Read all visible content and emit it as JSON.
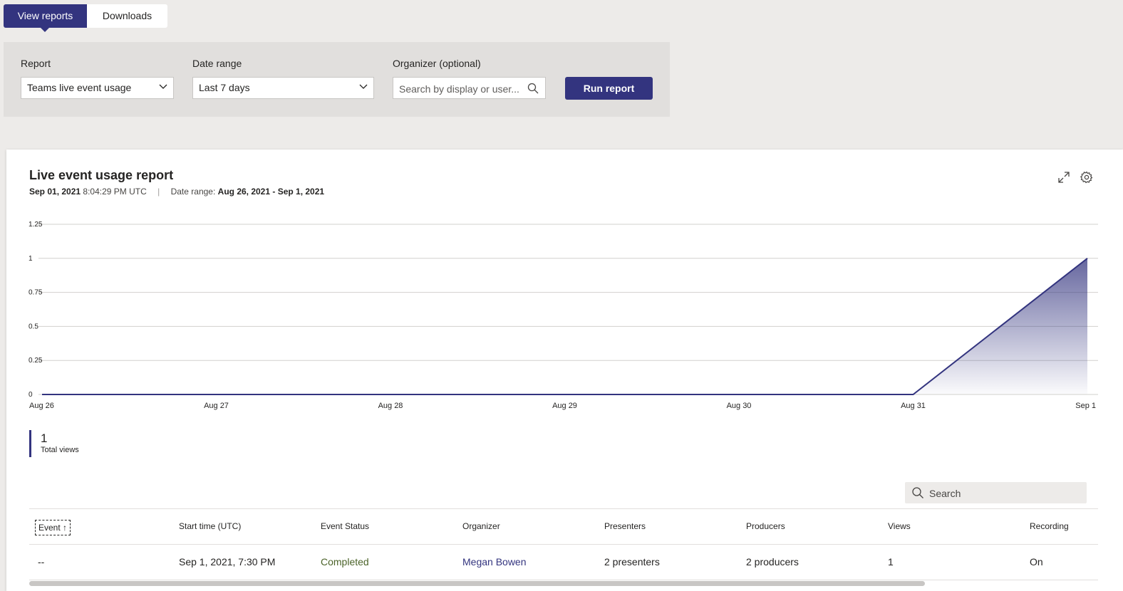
{
  "tabs": [
    {
      "label": "View reports",
      "active": true
    },
    {
      "label": "Downloads",
      "active": false
    }
  ],
  "filters": {
    "report_label": "Report",
    "report_value": "Teams live event usage",
    "date_label": "Date range",
    "date_value": "Last 7 days",
    "organizer_label": "Organizer (optional)",
    "organizer_placeholder": "Search by display or user...",
    "run_label": "Run report"
  },
  "report": {
    "title": "Live event usage report",
    "date": "Sep 01, 2021",
    "time": "8:04:29 PM UTC",
    "range_label": "Date range:",
    "range_value": "Aug 26, 2021 - Sep 1, 2021",
    "separator": "|"
  },
  "colors": {
    "accent": "#33347f",
    "completed": "#4b6329",
    "background": "#edebe9"
  },
  "icons": {
    "expand": "expand-icon",
    "settings": "gear-icon",
    "search": "search-icon",
    "dropdown": "chevron-down-icon",
    "sort": "arrow-up-icon"
  },
  "chart_data": {
    "type": "area",
    "x": [
      "Aug 26",
      "Aug 27",
      "Aug 28",
      "Aug 29",
      "Aug 30",
      "Aug 31",
      "Sep 1"
    ],
    "values": [
      0,
      0,
      0,
      0,
      0,
      0,
      1
    ],
    "yticks": [
      "0",
      "0.25",
      "0.5",
      "0.75",
      "1",
      "1.25"
    ],
    "ylim": [
      0,
      1.25
    ],
    "grid": true,
    "color": "#33347f"
  },
  "kpi": {
    "value": "1",
    "label": "Total views"
  },
  "table": {
    "search_placeholder": "Search",
    "columns": [
      "Event",
      "Start time (UTC)",
      "Event Status",
      "Organizer",
      "Presenters",
      "Producers",
      "Views",
      "Recording"
    ],
    "sort_indicator": "↑",
    "rows": [
      [
        "--",
        "Sep 1, 2021, 7:30 PM",
        "Completed",
        "Megan Bowen",
        "2 presenters",
        "2 producers",
        "1",
        "On"
      ]
    ]
  }
}
